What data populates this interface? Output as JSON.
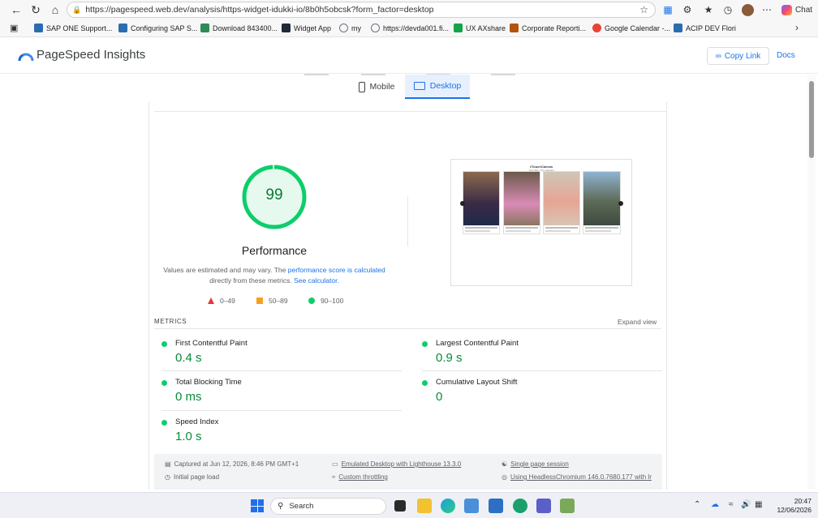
{
  "browser": {
    "url": "https://pagespeed.web.dev/analysis/https-widget-idukki-io/8b0h5obcsk?form_factor=desktop",
    "chat_label": "Chat",
    "bookmarks": [
      {
        "label": "SAP ONE Support...",
        "color": "#2b6cb0"
      },
      {
        "label": "Configuring SAP S...",
        "color": "#2b6cb0"
      },
      {
        "label": "Download 843400...",
        "color": "#2e8b57"
      },
      {
        "label": "Widget App",
        "color": "#1f2937"
      },
      {
        "label": "my",
        "color": "#6b7280"
      },
      {
        "label": "https://devda001.fi...",
        "color": "#6b7280"
      },
      {
        "label": "UX AXshare",
        "color": "#16a34a"
      },
      {
        "label": "Corporate Reporti...",
        "color": "#b45309"
      },
      {
        "label": "Google Calendar -...",
        "color": "#ea4335"
      },
      {
        "label": "ACIP DEV Flori",
        "color": "#2b6cb0"
      }
    ]
  },
  "header": {
    "brand": "PageSpeed Insights",
    "copy_link": "Copy Link",
    "docs": "Docs"
  },
  "tabs": {
    "mobile": "Mobile",
    "desktop": "Desktop",
    "active": "desktop"
  },
  "performance": {
    "score": "99",
    "score_fraction": 0.99,
    "title": "Performance",
    "note_part1": "Values are estimated and may vary. The ",
    "note_link1": "performance score is calculated",
    "note_part2": "directly from these metrics. ",
    "note_link2": "See calculator.",
    "legend": [
      {
        "range": "0–49",
        "shape": "triangle",
        "color": "#e53935"
      },
      {
        "range": "50–89",
        "shape": "square",
        "color": "#f4a21e"
      },
      {
        "range": "90–100",
        "shape": "circle",
        "color": "#0cce6b"
      }
    ],
    "good_color": "#0cce6b"
  },
  "screenshot": {
    "title": "#TouchCanvas",
    "subtitle": "Your Skin, Our Canvas!"
  },
  "metrics": {
    "label": "METRICS",
    "expand": "Expand view",
    "items": [
      {
        "name": "First Contentful Paint",
        "value": "0.4 s"
      },
      {
        "name": "Largest Contentful Paint",
        "value": "0.9 s"
      },
      {
        "name": "Total Blocking Time",
        "value": "0 ms"
      },
      {
        "name": "Cumulative Layout Shift",
        "value": "0"
      },
      {
        "name": "Speed Index",
        "value": "1.0 s"
      }
    ]
  },
  "footer": {
    "captured": "Captured at Jun 12, 2026, 8:46 PM GMT+1",
    "emulated": "Emulated Desktop with Lighthouse 13.3.0",
    "session": "Single page session",
    "initial": "Initial page load",
    "throttling": "Custom throttling",
    "chromium": "Using HeadlessChromium 146.0.7680.177 with lr"
  },
  "taskbar": {
    "search": "Search",
    "time": "20:47",
    "date": "12/06/2026"
  }
}
